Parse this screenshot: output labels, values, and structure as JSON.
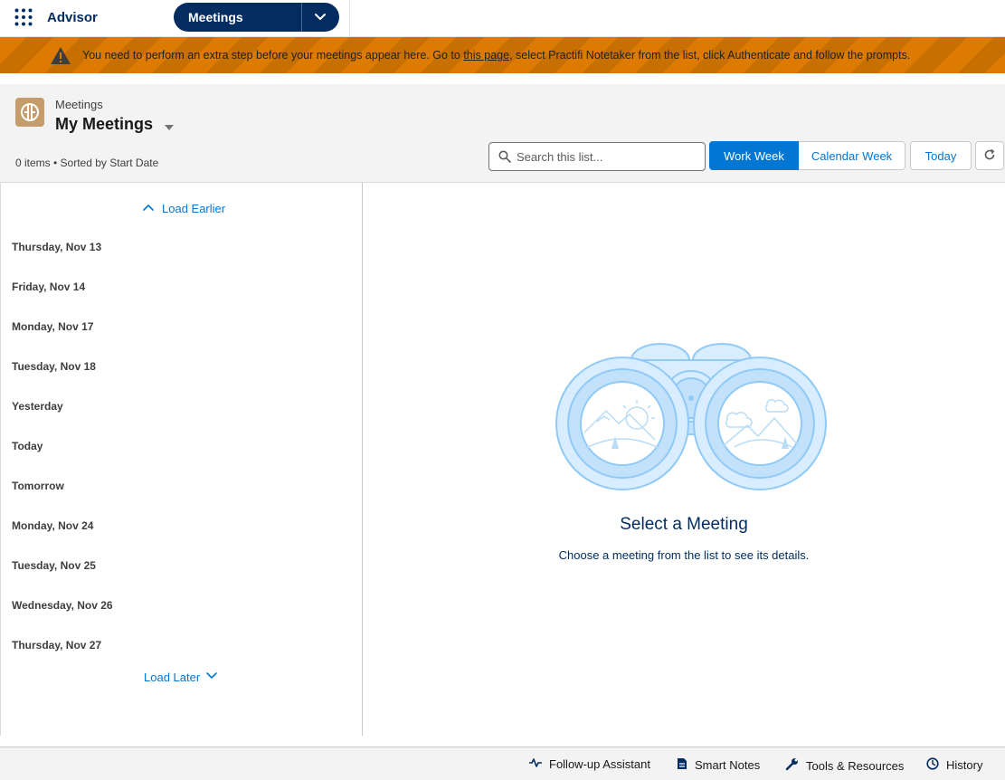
{
  "header": {
    "app_name": "Advisor",
    "nav_tab_label": "Meetings"
  },
  "banner": {
    "text_before": "You need to perform an extra step before your meetings appear here. Go to ",
    "link_text": "this page",
    "text_after": ", select Practifi Notetaker from the list, click Authenticate and follow the prompts.",
    "color": "#dd7a01"
  },
  "page": {
    "object_type": "Meetings",
    "list_title": "My Meetings",
    "meta": "0 items • Sorted by Start Date",
    "search_placeholder": "Search this list...",
    "btn_work_week": "Work Week",
    "btn_calendar_week": "Calendar Week",
    "btn_today": "Today"
  },
  "list": {
    "load_earlier": "Load Earlier",
    "load_later": "Load Later",
    "days": [
      "Thursday, Nov 13",
      "Friday, Nov 14",
      "Monday, Nov 17",
      "Tuesday, Nov 18",
      "Yesterday",
      "Today",
      "Tomorrow",
      "Monday, Nov 24",
      "Tuesday, Nov 25",
      "Wednesday, Nov 26",
      "Thursday, Nov 27"
    ]
  },
  "detail": {
    "empty_title": "Select a Meeting",
    "empty_subtitle": "Choose a meeting from the list to see its details."
  },
  "utility_bar": {
    "items": [
      "Follow-up Assistant",
      "Smart Notes",
      "Tools & Resources",
      "History"
    ]
  },
  "colors": {
    "brand": "#032d60",
    "accent": "#0176d3",
    "object_icon": "#c59c6c"
  }
}
